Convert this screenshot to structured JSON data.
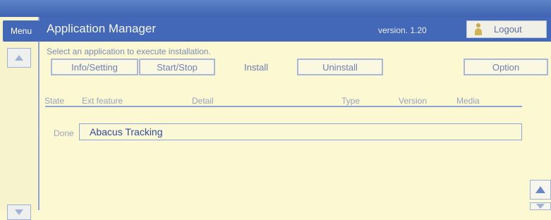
{
  "colors": {
    "header_bg": "#4468b8",
    "panel_bg": "#fbf8d2",
    "accent_line": "#8ea4d6"
  },
  "sidebar": {
    "menu_label": "Menu",
    "up_icon": "triangle-up-icon",
    "down_icon": "triangle-down-icon"
  },
  "header": {
    "title": "Application Manager",
    "version": "version. 1.20",
    "logout_label": "Logout",
    "logout_icon": "person-icon"
  },
  "instruction": "Select an application to execute installation.",
  "tabs": [
    {
      "label": "Info/Setting",
      "selected": false
    },
    {
      "label": "Start/Stop",
      "selected": false
    },
    {
      "label": "Install",
      "selected": true
    },
    {
      "label": "Uninstall",
      "selected": false
    }
  ],
  "option_label": "Option",
  "columns": [
    "State",
    "Ext feature",
    "Detail",
    "Type",
    "Version",
    "Media"
  ],
  "rows": [
    {
      "state": "Done",
      "name": "Abacus Tracking"
    }
  ]
}
